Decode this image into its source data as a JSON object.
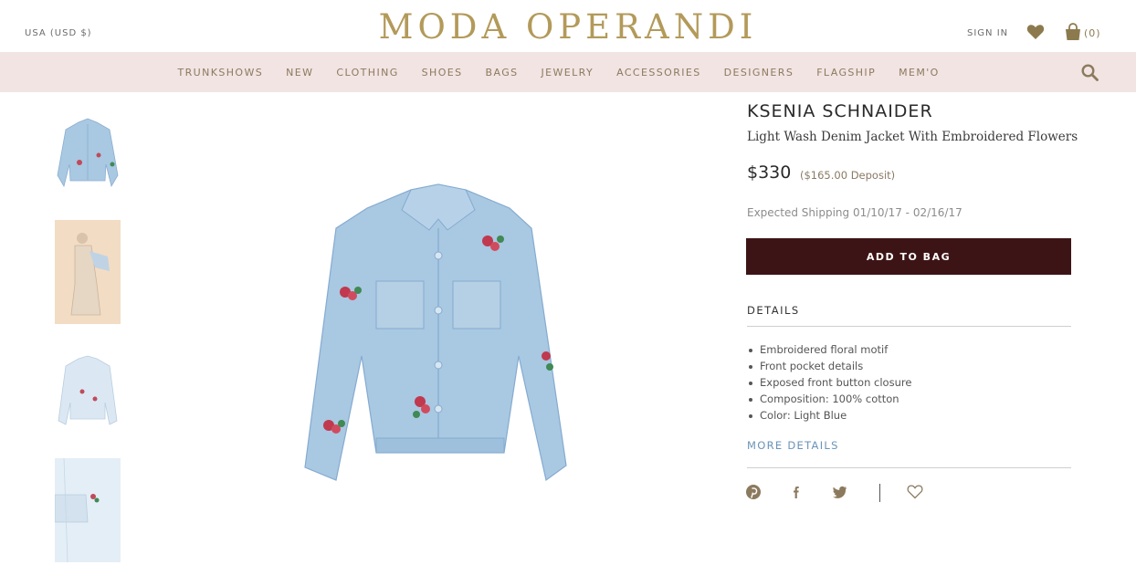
{
  "header": {
    "currency": "USA (USD $)",
    "logo": "MODA OPERANDI",
    "sign_in": "SIGN IN",
    "bag_count": "(0)"
  },
  "nav": {
    "items": [
      "TRUNKSHOWS",
      "NEW",
      "CLOTHING",
      "SHOES",
      "BAGS",
      "JEWELRY",
      "ACCESSORIES",
      "DESIGNERS",
      "FLAGSHIP",
      "MEM'O"
    ]
  },
  "product": {
    "brand": "KSENIA SCHNAIDER",
    "name": "Light Wash Denim Jacket With Embroidered Flowers",
    "price": "$330",
    "deposit": "($165.00 Deposit)",
    "shipping": "Expected Shipping 01/10/17 - 02/16/17",
    "add_to_bag": "ADD TO BAG",
    "details_heading": "DETAILS",
    "details": [
      "Embroidered floral motif",
      "Front pocket details",
      "Exposed front button closure",
      "Composition: 100% cotton",
      "Color: Light Blue"
    ],
    "more_details": "MORE DETAILS"
  },
  "icons": {
    "wishlist": "heart-icon",
    "bag": "shopping-bag-icon",
    "search": "search-icon",
    "share": [
      "pinterest-icon",
      "facebook-icon",
      "twitter-icon",
      "heart-outline-icon"
    ]
  },
  "colors": {
    "gold": "#b39a5a",
    "nav_bg": "#f2e4e3",
    "button_bg": "#3d1416",
    "link_blue": "#6a94b8"
  }
}
